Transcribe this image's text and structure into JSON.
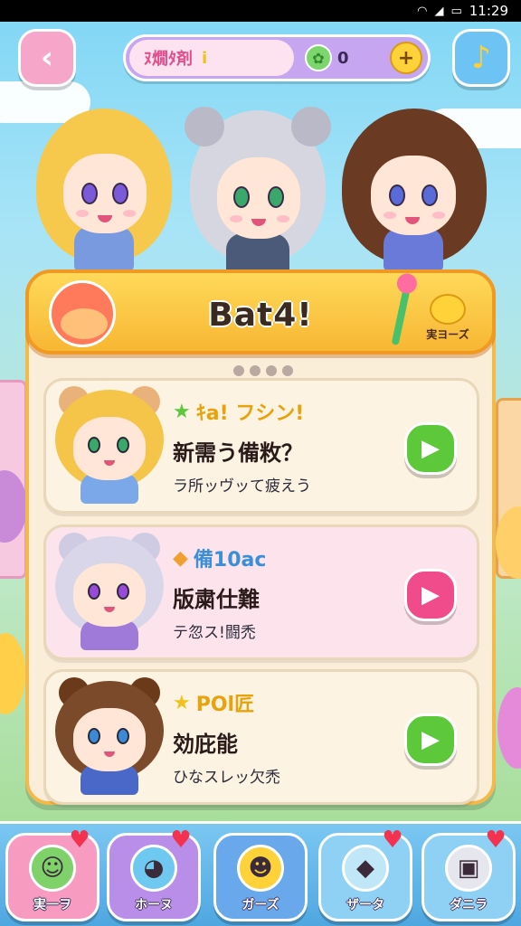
{
  "status_bar": {
    "time": "11:29",
    "wifi_icon": "wifi-icon",
    "signal_icon": "signal-icon",
    "battery_icon": "battery-icon"
  },
  "top_bar": {
    "back_icon": "back-arrow-icon",
    "currency_name": "ﾇ燗ﾀ剤",
    "currency_spark": "i",
    "gem_icon": "leaf-gem-icon",
    "currency_value": "0",
    "plus_label": "+",
    "bell_icon": "bell-icon"
  },
  "panel": {
    "title": "Bat4!",
    "badge_label": "実ヨーズ",
    "colors": {
      "header": "#f7b733",
      "panel": "#fbeed9"
    }
  },
  "quests": [
    {
      "tag": "ｷa! フシン!",
      "tag_color": "#e8a30c",
      "title": "新需う備敉？",
      "subtitle": "ラ所ッヴッて疲えう",
      "bg": "#fdf3e2",
      "play_color": "#5cc83a",
      "hair": "#f5c54a",
      "ear": "#e9b27a",
      "body": "#7aa8e8"
    },
    {
      "tag": "備10ac",
      "tag_color": "#3a8fd8",
      "title": "版粛仕難",
      "subtitle": "テ忽ス!闘禿",
      "bg": "#fde4ec",
      "play_color": "#f04b8a",
      "hair": "#d9d6ea",
      "ear": "#cfcbe2",
      "body": "#a07ad8"
    },
    {
      "tag": "POl匠",
      "tag_color": "#e8a30c",
      "title": "効庇能",
      "subtitle": "ひなスレッ欠禿",
      "bg": "#fdf3e2",
      "play_color": "#5cc83a",
      "hair": "#7a4a2a",
      "ear": "#6a3a1a",
      "body": "#4a68c8"
    }
  ],
  "bottom_nav": [
    {
      "label": "実一ヲ",
      "icon": "frog-icon",
      "bg": "#f79bc0",
      "icon_bg": "#7fd16a",
      "glyph": "☺"
    },
    {
      "label": "ホーヌ",
      "icon": "ghost-icon",
      "bg": "#b98ee8",
      "icon_bg": "#6fc8ef",
      "glyph": "◕"
    },
    {
      "label": "ガーズ",
      "icon": "smile-face-icon",
      "bg": "#6aa8ec",
      "icon_bg": "#ffd23a",
      "glyph": "☻"
    },
    {
      "label": "ザータ",
      "icon": "flag-icon",
      "bg": "#8fd0f5",
      "icon_bg": "#bfe7f8",
      "glyph": "◆"
    },
    {
      "label": "ダニラ",
      "icon": "robot-icon",
      "bg": "#8fd0f5",
      "icon_bg": "#e6e6ee",
      "glyph": "▣"
    }
  ]
}
